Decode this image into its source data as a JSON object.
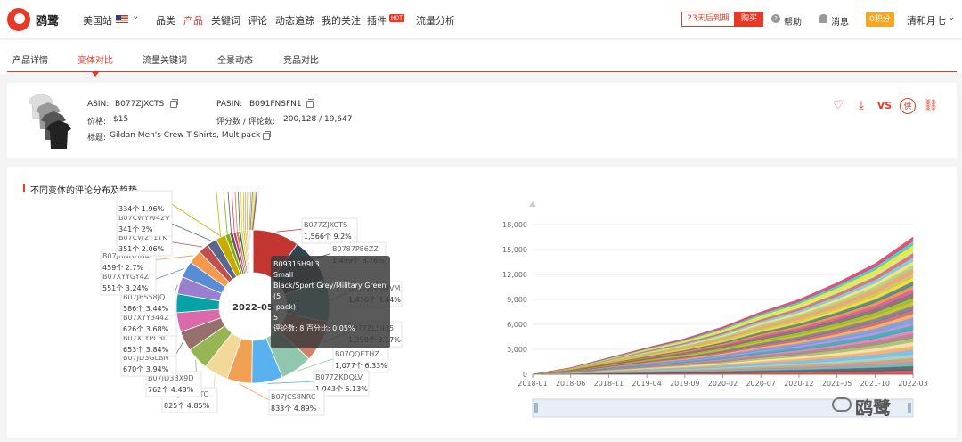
{
  "brand": {
    "name": "鸥鹭"
  },
  "topbar": {
    "site": "美国站",
    "nav": [
      "品类",
      "产品",
      "关键词",
      "评论",
      "动态追踪",
      "我的关注",
      "插件",
      "流量分析"
    ],
    "hot": "HOT",
    "expire": "23天后到期",
    "buy": "购买",
    "help": "帮助",
    "message": "消息",
    "points": "0积分",
    "user": "清和月七"
  },
  "tabs": [
    "产品详情",
    "变体对比",
    "流量关键词",
    "全景动态",
    "竞品对比"
  ],
  "product": {
    "asin_label": "ASIN:",
    "asin": "B077ZJXCTS",
    "pasin_label": "PASIN:",
    "pasin": "B091FNSFN1",
    "price_label": "价格:",
    "price": "$15",
    "rating_label": "评分数 / 评论数:",
    "rating": "200,128 / 19,647",
    "title_label": "标题:",
    "title": "Gildan Men's Crew T-Shirts, Multipack"
  },
  "chart": {
    "title": "不同变体的评论分布及趋势",
    "center_label": "2022-05",
    "watermark": "鸥鹭"
  },
  "tooltip": {
    "line1": "B09315H9L3",
    "line2": "Small",
    "line3": "Black/Sport Grey/Military Green (5",
    "line4": "-pack)",
    "line5": "5",
    "line6": "评论数: 8  百分比: 0.05%"
  },
  "chart_data": {
    "type": "pie",
    "donut_slices": [
      {
        "asin": "B077ZJXCTS",
        "count": "1,566个",
        "pct": "9.2%",
        "value": 1566,
        "color": "#c23531"
      },
      {
        "asin": "B0787P86ZZ",
        "count": "1,499个",
        "pct": "8.76%",
        "value": 1499,
        "color": "#2f4554"
      },
      {
        "asin": "B077ZMKWVM",
        "count": "1,436个",
        "pct": "8.44%",
        "value": 1436,
        "color": "#61a0a8"
      },
      {
        "asin": "B077ZL5935",
        "count": "1,390个",
        "pct": "8.17%",
        "value": 1390,
        "color": "#d48265"
      },
      {
        "asin": "B07QQETHZ",
        "count": "1,077个",
        "pct": "6.33%",
        "value": 1077,
        "color": "#91c7ae"
      },
      {
        "asin": "B077ZKDQLV",
        "count": "1,043个",
        "pct": "6.13%",
        "value": 1043,
        "color": "#5ab1ef"
      },
      {
        "asin": "B07JCS8NRC",
        "count": "833个",
        "pct": "4.89%",
        "value": 833,
        "color": "#f0a052"
      },
      {
        "asin": "B07JDFPQTC",
        "count": "825个",
        "pct": "4.85%",
        "value": 825,
        "color": "#f3d999"
      },
      {
        "asin": "B07JD3BX9D",
        "count": "762个",
        "pct": "4.48%",
        "value": 762,
        "color": "#97b552"
      },
      {
        "asin": "B07JD3GLBN",
        "count": "670个",
        "pct": "3.94%",
        "value": 670,
        "color": "#95706d"
      },
      {
        "asin": "B07XLYPC3L",
        "count": "653个",
        "pct": "3.84%",
        "value": 653,
        "color": "#dc69aa"
      },
      {
        "asin": "B07XYY344Z",
        "count": "626个",
        "pct": "3.68%",
        "value": 626,
        "color": "#07a2a4"
      },
      {
        "asin": "B07JBS58JQ",
        "count": "586个",
        "pct": "3.44%",
        "value": 586,
        "color": "#9a7fd1"
      },
      {
        "asin": "B07XYYGY4Z",
        "count": "551个",
        "pct": "3.24%",
        "value": 551,
        "color": "#588dd5"
      },
      {
        "asin": "B07JBNGHH4",
        "count": "459个",
        "pct": "2.7%",
        "value": 459,
        "color": "#f5994e"
      },
      {
        "asin": "B07CW2T1TK",
        "count": "351个",
        "pct": "2.06%",
        "value": 351,
        "color": "#c05050"
      },
      {
        "asin": "B07CWYW42V",
        "count": "341个",
        "pct": "2%",
        "value": 341,
        "color": "#59678c"
      },
      {
        "asin": "",
        "count": "334个",
        "pct": "1.96%",
        "value": 334,
        "color": "#c9ab00"
      },
      {
        "asin": "",
        "count": "",
        "pct": "",
        "value": 150,
        "color": "#7eb00a"
      },
      {
        "asin": "",
        "count": "",
        "pct": "",
        "value": 120,
        "color": "#6f5553"
      },
      {
        "asin": "",
        "count": "",
        "pct": "",
        "value": 100,
        "color": "#c14089"
      },
      {
        "asin": "",
        "count": "",
        "pct": "",
        "value": 90,
        "color": "#e87c25"
      },
      {
        "asin": "",
        "count": "",
        "pct": "",
        "value": 80,
        "color": "#27727b"
      },
      {
        "asin": "",
        "count": "",
        "pct": "",
        "value": 70,
        "color": "#fcce10"
      },
      {
        "asin": "",
        "count": "",
        "pct": "",
        "value": 60,
        "color": "#b5c334"
      },
      {
        "asin": "",
        "count": "",
        "pct": "",
        "value": 50,
        "color": "#fe8463"
      },
      {
        "asin": "",
        "count": "",
        "pct": "",
        "value": 45,
        "color": "#9bca63"
      },
      {
        "asin": "",
        "count": "",
        "pct": "",
        "value": 40,
        "color": "#fad860"
      },
      {
        "asin": "",
        "count": "",
        "pct": "",
        "value": 35,
        "color": "#60c0dd"
      },
      {
        "asin": "",
        "count": "",
        "pct": "",
        "value": 30,
        "color": "#d7504b"
      },
      {
        "asin": "",
        "count": "",
        "pct": "",
        "value": 25,
        "color": "#c6e579"
      },
      {
        "asin": "",
        "count": "",
        "pct": "",
        "value": 20,
        "color": "#f4e001"
      },
      {
        "asin": "",
        "count": "",
        "pct": "",
        "value": 15,
        "color": "#26c0c0"
      },
      {
        "asin": "",
        "count": "",
        "pct": "",
        "value": 10,
        "color": "#e01f54"
      }
    ],
    "area": {
      "x_ticks": [
        "2018-01",
        "2018-06",
        "2018-11",
        "2019-04",
        "2019-09",
        "2020-02",
        "2020-07",
        "2020-12",
        "2021-05",
        "2021-10",
        "2022-03"
      ],
      "y_ticks": [
        "0",
        "3,000",
        "6,000",
        "9,000",
        "12,000",
        "15,000",
        "18,000"
      ],
      "ylim": [
        0,
        18000
      ],
      "total": [
        0,
        800,
        2000,
        3200,
        4300,
        5700,
        7500,
        9000,
        11000,
        13300,
        16500
      ],
      "bands": 34
    }
  }
}
